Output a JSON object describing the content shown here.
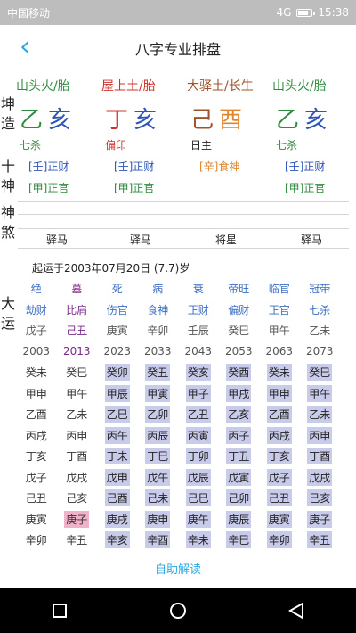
{
  "status": {
    "carrier": "中国移动",
    "time": "15:38",
    "network": "4G",
    "battery_level": 0.85
  },
  "header": {
    "title": "八字专业排盘"
  },
  "side_labels": {
    "kunzao": [
      "坤",
      "造"
    ],
    "shishen": [
      "十",
      "神"
    ],
    "shensha": [
      "神",
      "煞"
    ],
    "dayun": [
      "大",
      "运"
    ]
  },
  "pillars": [
    {
      "nayin": "山头火/胎",
      "stem": "乙",
      "branch": "亥",
      "god": "七杀",
      "hidden": [
        "[壬]正财",
        "[甲]正官"
      ],
      "colors": {
        "nayin": "#2e8b3e",
        "stem": "#2e8b3e",
        "branch": "#2e55b8",
        "god": "#2e8b3e",
        "hidden": [
          "#2e55b8",
          "#2e8b3e"
        ]
      }
    },
    {
      "nayin": "屋上土/胎",
      "stem": "丁",
      "branch": "亥",
      "god": "偏印",
      "hidden": [
        "[壬]正财",
        "[甲]正官"
      ],
      "colors": {
        "nayin": "#d0302b",
        "stem": "#d0302b",
        "branch": "#2e55b8",
        "god": "#d0302b",
        "hidden": [
          "#2e55b8",
          "#2e8b3e"
        ]
      }
    },
    {
      "nayin": "大驿土/长生",
      "stem": "己",
      "branch": "酉",
      "god": "日主",
      "hidden": [
        "[辛]食神"
      ],
      "colors": {
        "nayin": "#a0522d",
        "stem": "#a0522d",
        "branch": "#e0862f",
        "god": "#222222",
        "hidden": [
          "#e0862f"
        ]
      }
    },
    {
      "nayin": "山头火/胎",
      "stem": "乙",
      "branch": "亥",
      "god": "七杀",
      "hidden": [
        "[壬]正财",
        "[甲]正官"
      ],
      "colors": {
        "nayin": "#2e8b3e",
        "stem": "#2e8b3e",
        "branch": "#2e55b8",
        "god": "#2e8b3e",
        "hidden": [
          "#2e55b8",
          "#2e8b3e"
        ]
      }
    }
  ],
  "shensha": [
    "驿马",
    "驿马",
    "将星",
    "驿马"
  ],
  "qiyun": "起运于2003年07月20日 (7.7)岁",
  "dayun": {
    "row_states": [
      "绝",
      "墓",
      "死",
      "病",
      "衰",
      "帝旺",
      "临官",
      "冠带"
    ],
    "row_gods": [
      "劫财",
      "比肩",
      "伤官",
      "食神",
      "正财",
      "偏财",
      "正官",
      "七杀"
    ],
    "row_ganzhi": [
      "戊子",
      "己丑",
      "庚寅",
      "辛卯",
      "壬辰",
      "癸巳",
      "甲午",
      "乙未"
    ],
    "row_years": [
      "2003",
      "2013",
      "2023",
      "2033",
      "2043",
      "2053",
      "2063",
      "2073"
    ],
    "liunian": [
      [
        "癸未",
        "癸巳",
        "癸卯",
        "癸丑",
        "癸亥",
        "癸酉",
        "癸未",
        "癸巳"
      ],
      [
        "甲申",
        "甲午",
        "甲辰",
        "甲寅",
        "甲子",
        "甲戌",
        "甲申",
        "甲午"
      ],
      [
        "乙酉",
        "乙未",
        "乙巳",
        "乙卯",
        "乙丑",
        "乙亥",
        "乙酉",
        "乙未"
      ],
      [
        "丙戌",
        "丙申",
        "丙午",
        "丙辰",
        "丙寅",
        "丙子",
        "丙戌",
        "丙申"
      ],
      [
        "丁亥",
        "丁酉",
        "丁未",
        "丁巳",
        "丁卯",
        "丁丑",
        "丁亥",
        "丁酉"
      ],
      [
        "戊子",
        "戊戌",
        "戊申",
        "戊午",
        "戊辰",
        "戊寅",
        "戊子",
        "戊戌"
      ],
      [
        "己丑",
        "己亥",
        "己酉",
        "己未",
        "己巳",
        "己卯",
        "己丑",
        "己亥"
      ],
      [
        "庚寅",
        "庚子",
        "庚戌",
        "庚申",
        "庚午",
        "庚辰",
        "庚寅",
        "庚子"
      ],
      [
        "辛卯",
        "辛丑",
        "辛亥",
        "辛酉",
        "辛未",
        "辛巳",
        "辛卯",
        "辛丑"
      ]
    ],
    "colors": {
      "state": "#3b6dc4",
      "state_hl": "#8a2f8a",
      "god": "#3b6dc4",
      "god_hl": "#7a2a8a",
      "ganzhi": "#555555",
      "ganzhi_hl": "#7a2a8a",
      "year": "#555555",
      "year_hl": "#7a2a8a"
    }
  },
  "footer": {
    "interpret_label": "自助解读"
  }
}
